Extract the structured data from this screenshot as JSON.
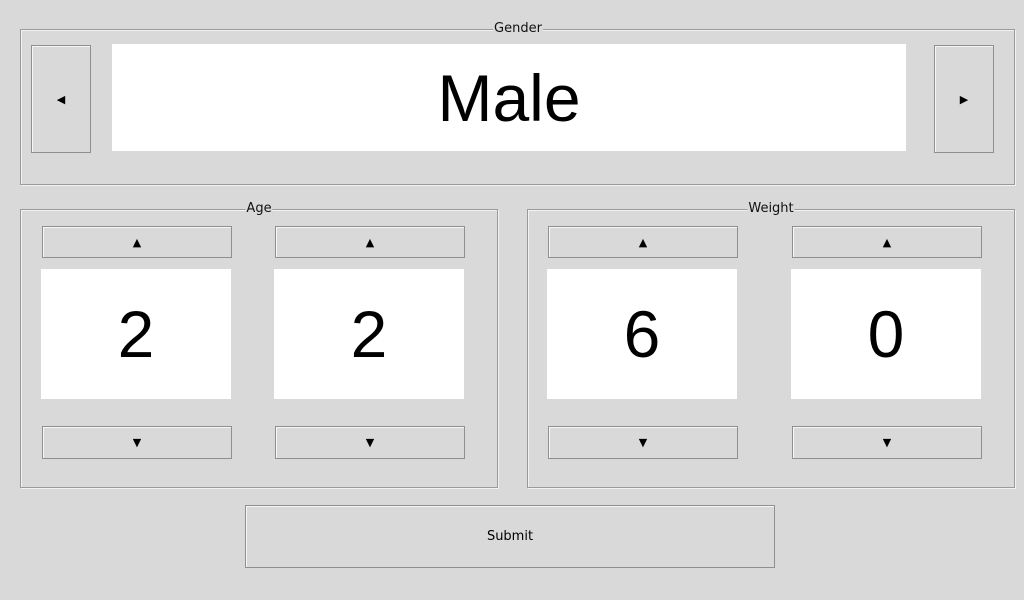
{
  "gender": {
    "label": "Gender",
    "value": "Male",
    "prev_icon": "left-triangle-icon",
    "next_icon": "right-triangle-icon"
  },
  "age": {
    "label": "Age",
    "digits": [
      "2",
      "2"
    ]
  },
  "weight": {
    "label": "Weight",
    "digits": [
      "6",
      "0"
    ]
  },
  "icons": {
    "up": "▲",
    "down": "▼",
    "left": "◀",
    "right": "▶"
  },
  "submit": {
    "label": "Submit"
  }
}
